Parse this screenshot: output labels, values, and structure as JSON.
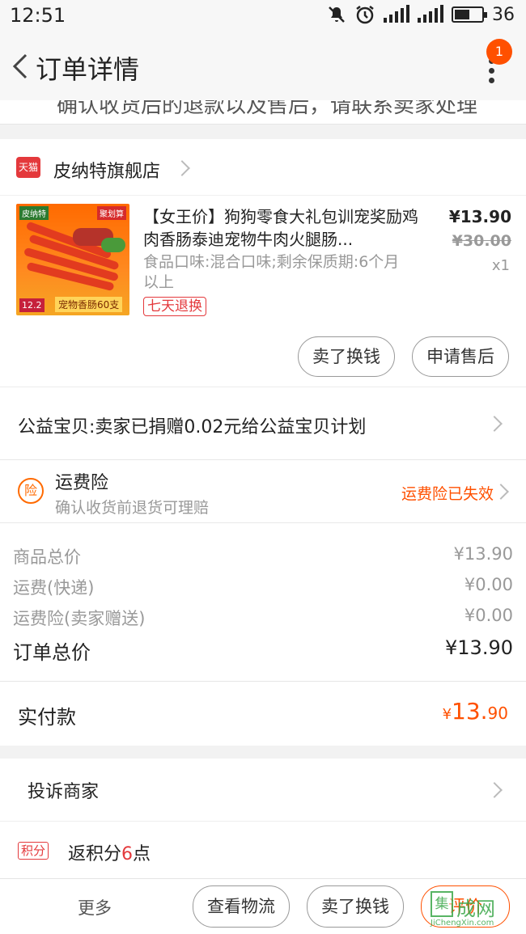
{
  "status_bar": {
    "time": "12:51",
    "battery": "36"
  },
  "nav": {
    "title": "订单详情",
    "badge": "1"
  },
  "cut_text": "确认收货后的退款以及售后，请联系卖家处理",
  "shop": {
    "name": "皮纳特旗舰店",
    "logo_text": "天猫"
  },
  "product": {
    "title": "【女王价】狗狗零食大礼包训宠奖励鸡肉香肠泰迪宠物牛肉火腿肠...",
    "spec": "食品口味:混合口味;剩余保质期:6个月以上",
    "return_tag": "七天退换",
    "price": "¥13.90",
    "original_price": "¥30.00",
    "qty": "x1",
    "image": {
      "brand": "皮纳特",
      "tag": "聚划算",
      "price_tag": "12.2",
      "caption": "宠物香肠60支"
    },
    "buttons": {
      "sell": "卖了换钱",
      "after_sale": "申请售后"
    }
  },
  "charity": {
    "text": "公益宝贝:卖家已捐赠0.02元给公益宝贝计划"
  },
  "insurance": {
    "icon_text": "险",
    "title": "运费险",
    "subtitle": "确认收货前退货可理赔",
    "status": "运费险已失效"
  },
  "prices": {
    "rows": [
      {
        "label": "商品总价",
        "value": "¥13.90"
      },
      {
        "label": "运费(快递)",
        "value": "¥0.00"
      },
      {
        "label": "运费险(卖家赠送)",
        "value": "¥0.00"
      }
    ],
    "total_label": "订单总价",
    "total_value": "¥13.90"
  },
  "paid": {
    "label": "实付款",
    "currency": "¥",
    "integer": "13.",
    "decimal": "90"
  },
  "complain": {
    "text": "投诉商家"
  },
  "points": {
    "icon_text": "积分",
    "prefix": "返积分",
    "num": "6",
    "suffix": "点"
  },
  "bottom": {
    "more": "更多",
    "logistics": "查看物流",
    "sell": "卖了换钱",
    "review": "评价"
  },
  "watermark": {
    "box": "集",
    "text": "成网",
    "url": "JiChengXin.com"
  },
  "colors": {
    "accent": "#ff5000",
    "tmall": "#e4393c"
  }
}
